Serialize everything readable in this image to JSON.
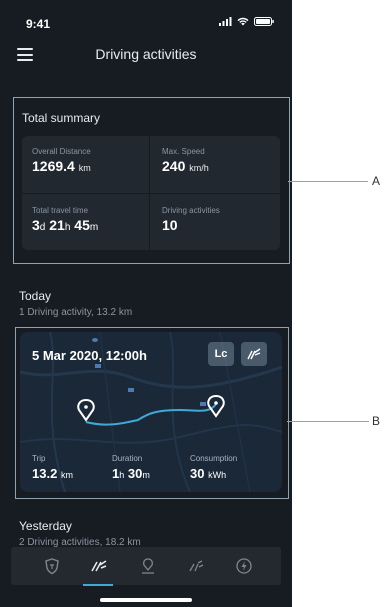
{
  "status_bar": {
    "time": "9:41"
  },
  "header": {
    "title": "Driving activities",
    "menu_icon": "hamburger-icon"
  },
  "summary": {
    "title": "Total summary",
    "overall_distance": {
      "label": "Overall Distance",
      "value": "1269.4",
      "unit": "km"
    },
    "max_speed": {
      "label": "Max. Speed",
      "value": "240",
      "unit": "km/h"
    },
    "travel_time": {
      "label": "Total travel time",
      "d": "3",
      "d_unit": "d",
      "h": "21",
      "h_unit": "h",
      "m": "45",
      "m_unit": "m"
    },
    "activities": {
      "label": "Driving activities",
      "value": "10"
    }
  },
  "today": {
    "title": "Today",
    "subtitle": "1 Driving activity, 13.2 km",
    "card": {
      "date": "5 Mar 2020, 12:00h",
      "badge_initials": "Lc",
      "trip": {
        "label": "Trip",
        "value": "13.2",
        "unit": "km"
      },
      "duration": {
        "label": "Duration",
        "h": "1",
        "h_unit": "h",
        "m": "30",
        "m_unit": "m"
      },
      "consumption": {
        "label": "Consumption",
        "value": "30",
        "unit": "kWh"
      }
    }
  },
  "yesterday": {
    "title": "Yesterday",
    "subtitle": "2 Driving activities, 18.2 km"
  },
  "bottom_nav": {
    "items": [
      "shield-icon",
      "route-icon",
      "location-icon",
      "road-icon",
      "lightning-icon"
    ],
    "active_index": 1
  },
  "callouts": {
    "a": "A",
    "b": "B"
  },
  "colors": {
    "background": "#171c22",
    "card": "#222830",
    "accent": "#3fa9d8",
    "frame": "#8fa2b2"
  }
}
